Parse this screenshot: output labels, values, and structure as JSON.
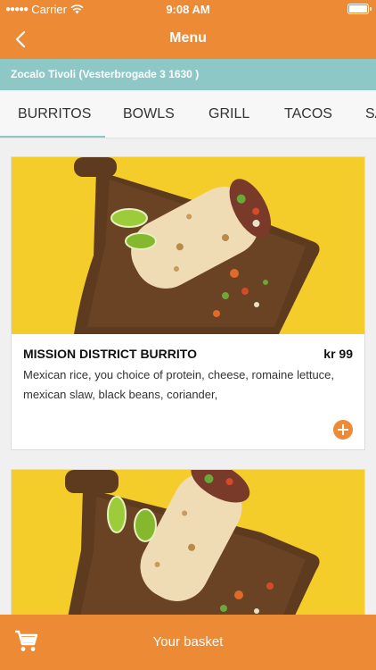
{
  "status": {
    "carrier": "Carrier",
    "time": "9:08 AM"
  },
  "nav": {
    "title": "Menu"
  },
  "location": {
    "text": "Zocalo Tivoli (Vesterbrogade 3 1630 )"
  },
  "tabs": [
    {
      "label": "BURRITOS",
      "active": true
    },
    {
      "label": "BOWLS"
    },
    {
      "label": "GRILL"
    },
    {
      "label": "TACOS"
    },
    {
      "label": "SALADS"
    }
  ],
  "items": [
    {
      "name": "MISSION DISTRICT BURRITO",
      "price": "kr 99",
      "description": "Mexican rice, you choice of protein, cheese, romaine lettuce, mexican slaw, black beans, coriander,"
    }
  ],
  "basket": {
    "label": "Your basket"
  },
  "colors": {
    "primary": "#ec8a35",
    "accent": "#8ec8c6",
    "image_bg": "#f5cd2a"
  }
}
